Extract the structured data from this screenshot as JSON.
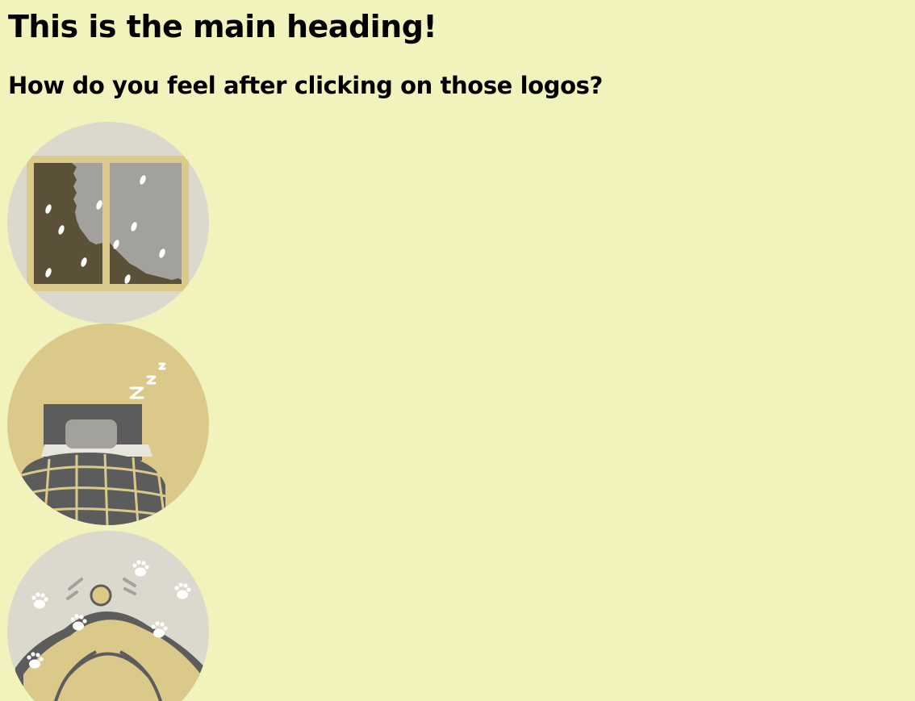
{
  "page": {
    "heading": "This is the main heading!",
    "subheading": "How do you feel after clicking on those logos?",
    "background_color": "#f2f2bc"
  },
  "logos": [
    {
      "icon": "snowy-window-icon",
      "description_color": "#dbd9ce"
    },
    {
      "icon": "sleeping-bed-icon",
      "description_color": "#dbc98a"
    },
    {
      "icon": "dog-with-paw-prints-icon",
      "description_color": "#dbd9ce"
    }
  ],
  "palette": {
    "light_gray": "#dbd9ce",
    "tan": "#dbc98a",
    "dark_gray": "#5c5c5c",
    "olive_dark": "#5a5138",
    "window_gray": "#a3a19c",
    "white": "#ffffff"
  },
  "bed": {
    "zzz": "z z z"
  }
}
